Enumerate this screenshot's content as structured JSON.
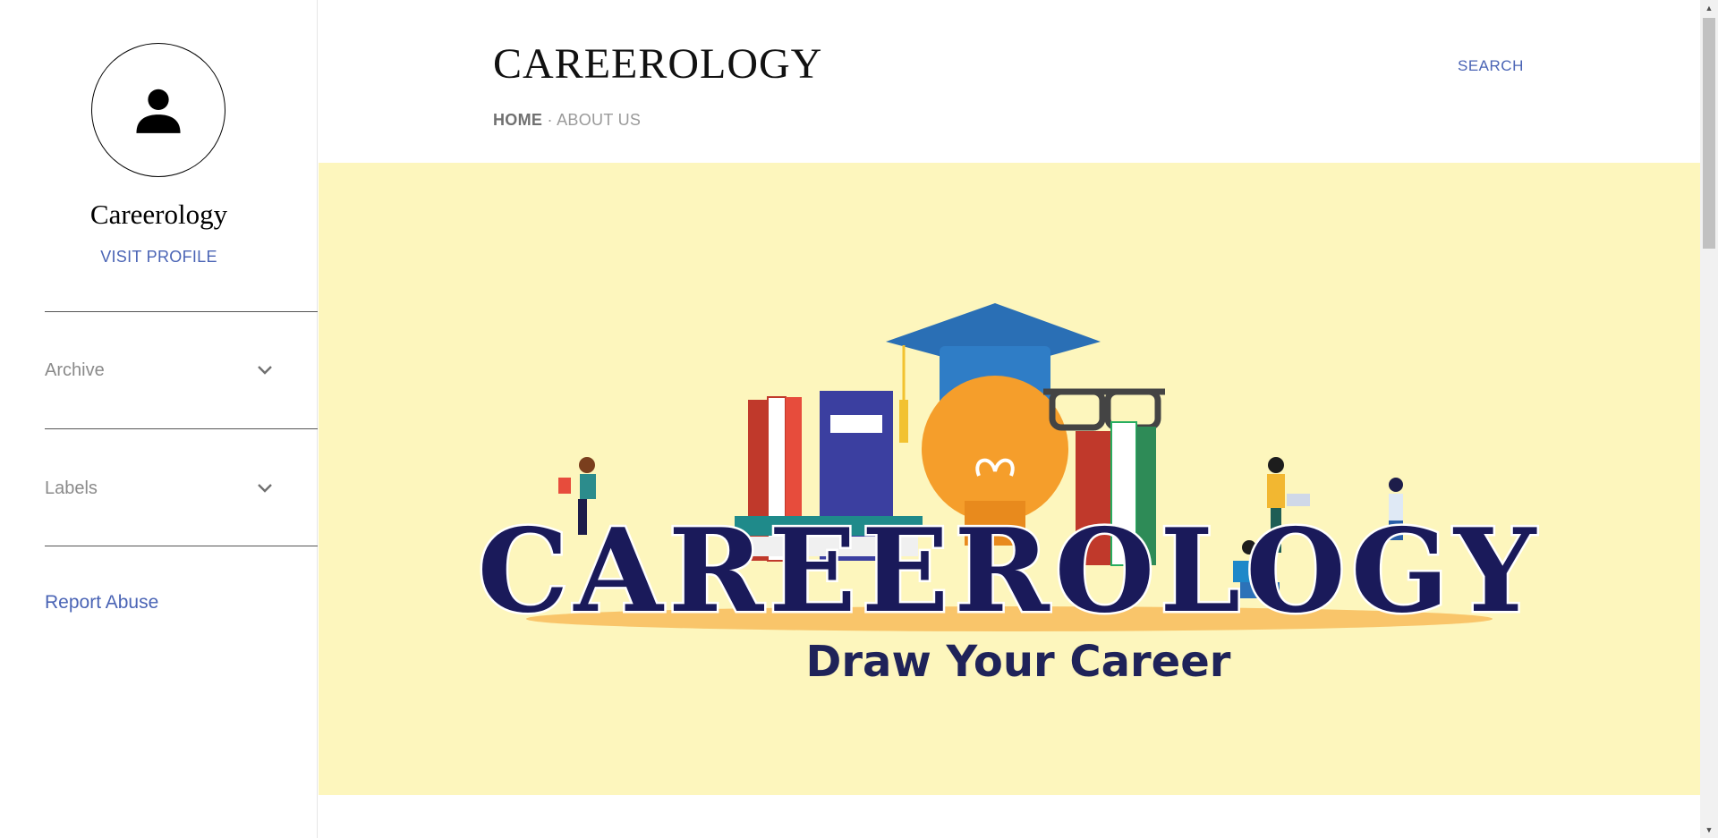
{
  "sidebar": {
    "profile_name": "Careerology",
    "visit_profile": "VISIT PROFILE",
    "sections": [
      {
        "label": "Archive"
      },
      {
        "label": "Labels"
      }
    ],
    "report_abuse": "Report Abuse"
  },
  "header": {
    "title": "CAREEROLOGY",
    "nav_home": "HOME",
    "nav_separator": "·",
    "nav_about": "ABOUT US",
    "search": "SEARCH"
  },
  "banner": {
    "title": "CAREEROLOGY",
    "tagline": "Draw Your Career",
    "background_color": "#fdf6bd"
  },
  "colors": {
    "accent": "#4a64b5",
    "banner_text": "#1a1a5a"
  }
}
